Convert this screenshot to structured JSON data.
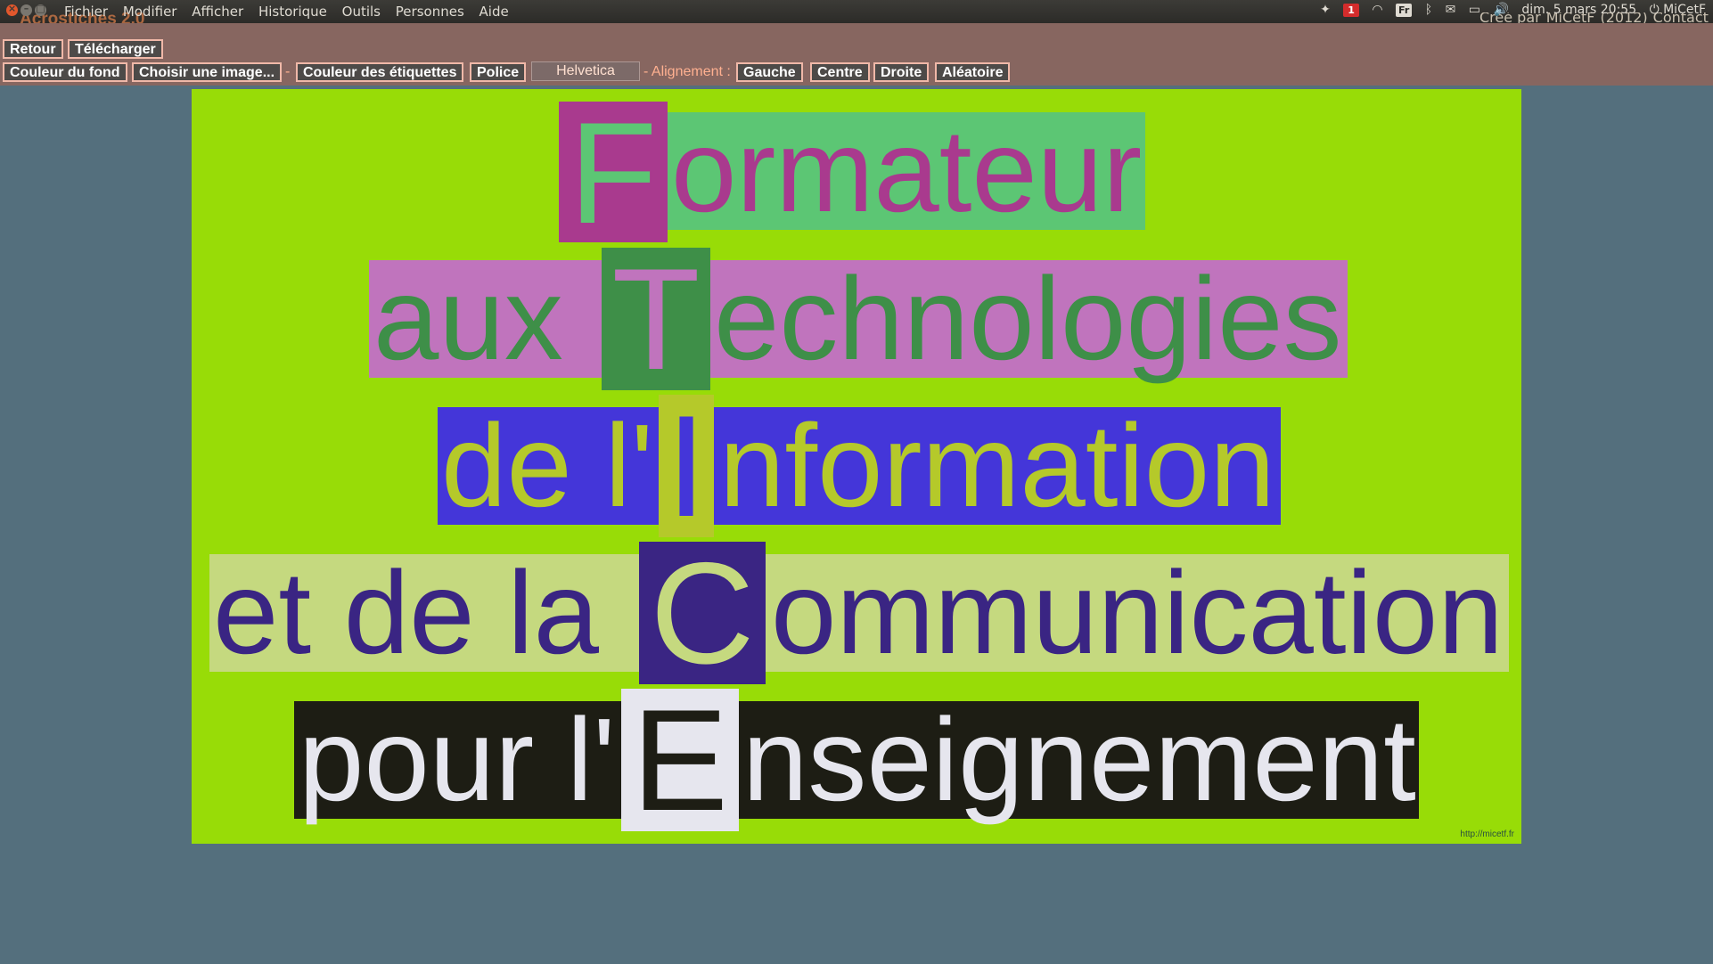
{
  "menubar": {
    "menus": [
      "Fichier",
      "Modifier",
      "Afficher",
      "Historique",
      "Outils",
      "Personnes",
      "Aide"
    ],
    "app_title": "Acrostiches 2.0",
    "credits": {
      "prefix": "Créé par",
      "author": "MiCetF",
      "year": "(2012)",
      "contact": "Contact"
    },
    "tray": {
      "notification_count": "1",
      "keyboard": "Fr",
      "datetime": "dim. 5 mars 20:55",
      "user": "MiCetF",
      "icons": [
        "dropbox-icon",
        "wifi-icon",
        "bluetooth-icon",
        "mail-icon",
        "battery-icon",
        "volume-icon",
        "power-icon"
      ]
    }
  },
  "toolbar": {
    "back": "Retour",
    "download": "Télécharger",
    "bg_color": "Couleur du fond",
    "choose_image": "Choisir une image...",
    "sep1": "-",
    "label_color": "Couleur des étiquettes",
    "font": "Police",
    "font_value": "Helvetica",
    "align_label": "- Alignement :",
    "align_left": "Gauche",
    "align_center": "Centre",
    "align_right": "Droite",
    "random": "Aléatoire"
  },
  "acrostic": {
    "canvas_bg": "#98dc07",
    "url": "http://micetf.fr",
    "lines": [
      {
        "before": "",
        "initial": "F",
        "after": "ormateur",
        "bg": "#5cc674",
        "text_color": "#a93a8e",
        "initial_bg": "#a93a8e",
        "initial_color": "#5cc674"
      },
      {
        "before": "aux ",
        "initial": "T",
        "after": "echnologies",
        "bg": "#c074bd",
        "text_color": "#3e8f48",
        "initial_bg": "#3e8f48",
        "initial_color": "#c074bd"
      },
      {
        "before": "de l'",
        "initial": "I",
        "after": "nformation",
        "bg": "#4436d9",
        "text_color": "#b5c92a",
        "initial_bg": "#b5c92a",
        "initial_color": "#4436d9"
      },
      {
        "before": "et de la ",
        "initial": "C",
        "after": "ommunication",
        "bg": "#c5d97f",
        "text_color": "#3a2583",
        "initial_bg": "#3a2583",
        "initial_color": "#c5d97f"
      },
      {
        "before": "pour l'",
        "initial": "E",
        "after": "nseignement",
        "bg": "#1d1d14",
        "text_color": "#e6e6ee",
        "initial_bg": "#e6e6ee",
        "initial_color": "#1d1d14"
      }
    ]
  }
}
